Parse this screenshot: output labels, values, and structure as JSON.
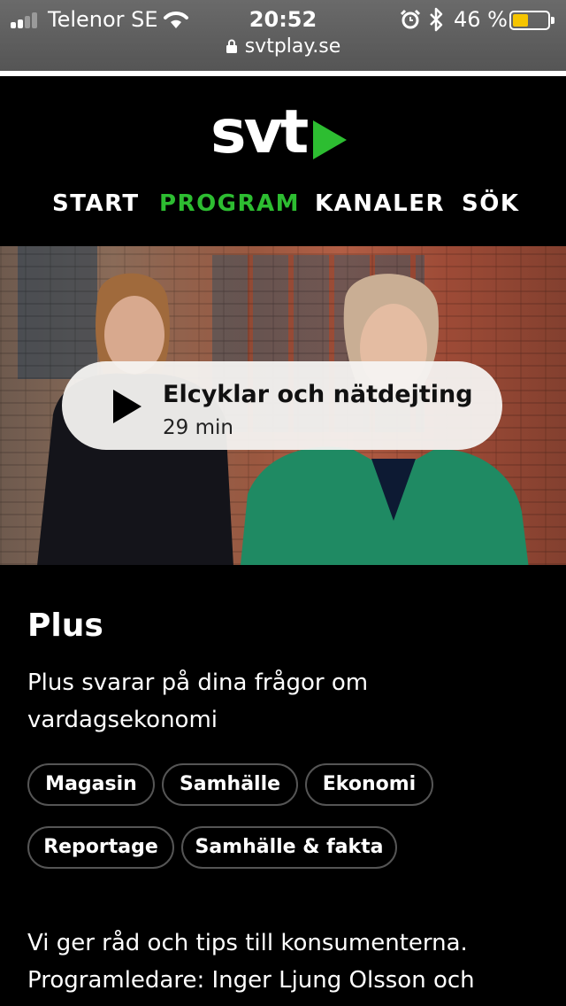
{
  "status_bar": {
    "carrier": "Telenor SE",
    "time": "20:52",
    "battery_percent": "46 %",
    "battery_level": 0.46,
    "url": "svtplay.se",
    "icons": [
      "signal-icon",
      "wifi-icon",
      "alarm-icon",
      "bluetooth-icon",
      "battery-icon",
      "lock-icon"
    ],
    "battery_color": "#f6c500"
  },
  "header": {
    "logo_text": "svt",
    "nav": [
      {
        "label": "START",
        "active": false
      },
      {
        "label": "PROGRAM",
        "active": true
      },
      {
        "label": "KANALER",
        "active": false
      },
      {
        "label": "SÖK",
        "active": false
      }
    ],
    "accent_color": "#2dbd31"
  },
  "hero": {
    "episode_title": "Elcyklar och nätdejting",
    "duration": "29 min"
  },
  "program": {
    "title": "Plus",
    "short_description": "Plus svarar på dina frågor om vardagsekonomi",
    "tags": [
      "Magasin",
      "Samhälle",
      "Ekonomi",
      "Reportage",
      "Samhälle & fakta"
    ],
    "long_description_line1": "Vi ger råd och tips till konsumenterna.",
    "long_description_line2": "Programledare: Inger Ljung Olsson och"
  }
}
